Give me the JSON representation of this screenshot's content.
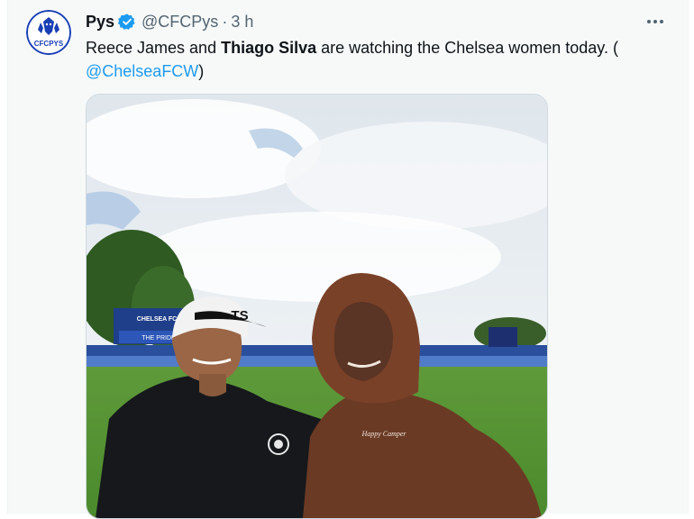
{
  "tweet": {
    "display_name": "Pys",
    "handle": "@CFCPys",
    "separator": "·",
    "time": "3 h",
    "text_part1": "Reece James and ",
    "text_bold": "Thiago Silva",
    "text_part2": " are watching the Chelsea women today. (",
    "mention": "@ChelseaFCW",
    "text_close": ")",
    "avatar_text": "CFCPYS",
    "media_signs": {
      "stand_top": "CHELSEA FC",
      "stand_banner": "THE PRIDE"
    },
    "hoodie_text": "Happy Camper",
    "cap_text": "TS"
  },
  "colors": {
    "verified": "#1d9bf0",
    "link": "#1d9bf0",
    "avatar_blue": "#1a3fb4"
  },
  "icons": {
    "verified": "verified-badge-icon",
    "more": "more-dots-icon"
  }
}
